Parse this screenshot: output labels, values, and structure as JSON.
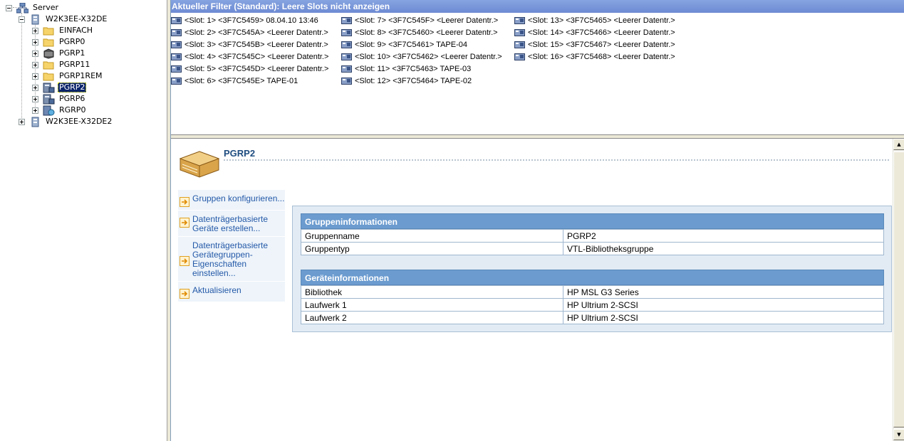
{
  "tree": {
    "root": {
      "label": "Server",
      "icon": "server-network-icon"
    },
    "server1": {
      "label": "W2K3EE-X32DE",
      "icon": "server-icon"
    },
    "groups": [
      {
        "label": "EINFACH",
        "icon": "folder-icon"
      },
      {
        "label": "PGRP0",
        "icon": "folder-icon"
      },
      {
        "label": "PGRP1",
        "icon": "tape-library-icon"
      },
      {
        "label": "PGRP11",
        "icon": "folder-icon"
      },
      {
        "label": "PGRP1REM",
        "icon": "folder-icon"
      },
      {
        "label": "PGRP2",
        "icon": "vtl-library-icon",
        "selected": true
      },
      {
        "label": "PGRP6",
        "icon": "vtl-library-icon"
      },
      {
        "label": "RGRP0",
        "icon": "replication-group-icon"
      }
    ],
    "server2": {
      "label": "W2K3EE-X32DE2",
      "icon": "server-icon"
    }
  },
  "slot_pane": {
    "filter_text": "Aktueller Filter (Standard): Leere Slots nicht anzeigen",
    "columns": [
      [
        "<Slot:  1> <3F7C5459> 08.04.10 13:46",
        "<Slot:  2> <3F7C545A> <Leerer Datentr.>",
        "<Slot:  3> <3F7C545B> <Leerer Datentr.>",
        "<Slot:  4> <3F7C545C> <Leerer Datentr.>",
        "<Slot:  5> <3F7C545D> <Leerer Datentr.>",
        "<Slot:  6> <3F7C545E> TAPE-01"
      ],
      [
        "<Slot:  7> <3F7C545F> <Leerer Datentr.>",
        "<Slot:  8> <3F7C5460> <Leerer Datentr.>",
        "<Slot:  9> <3F7C5461> TAPE-04",
        "<Slot: 10> <3F7C5462> <Leerer Datentr.>",
        "<Slot: 11> <3F7C5463> TAPE-03",
        "<Slot: 12> <3F7C5464> TAPE-02"
      ],
      [
        "<Slot: 13> <3F7C5465> <Leerer Datentr.>",
        "<Slot: 14> <3F7C5466> <Leerer Datentr.>",
        "<Slot: 15> <3F7C5467> <Leerer Datentr.>",
        "<Slot: 16> <3F7C5468> <Leerer Datentr.>"
      ]
    ]
  },
  "detail": {
    "title": "PGRP2",
    "tasks": [
      {
        "label": "Gruppen konfigurieren..."
      },
      {
        "label": "Datenträgerbasierte Geräte erstellen..."
      },
      {
        "label": "Datenträgerbasierte Gerätegruppen-Eigenschaften einstellen..."
      },
      {
        "label": "Aktualisieren"
      }
    ],
    "group_info": {
      "header": "Gruppeninformationen",
      "rows": [
        {
          "key": "Gruppenname",
          "value": "PGRP2"
        },
        {
          "key": "Gruppentyp",
          "value": "VTL-Bibliotheksgruppe"
        }
      ]
    },
    "device_info": {
      "header": "Geräteinformationen",
      "rows": [
        {
          "key": "Bibliothek",
          "value": "HP MSL G3 Series"
        },
        {
          "key": "Laufwerk 1",
          "value": "HP Ultrium 2-SCSI"
        },
        {
          "key": "Laufwerk 2",
          "value": "HP Ultrium 2-SCSI"
        }
      ]
    }
  },
  "colors": {
    "filter_bar": "#7a96df",
    "selection": "#0a246a",
    "title_blue": "#1f4d80",
    "task_link": "#2459a8",
    "info_header": "#6b9bcf"
  }
}
